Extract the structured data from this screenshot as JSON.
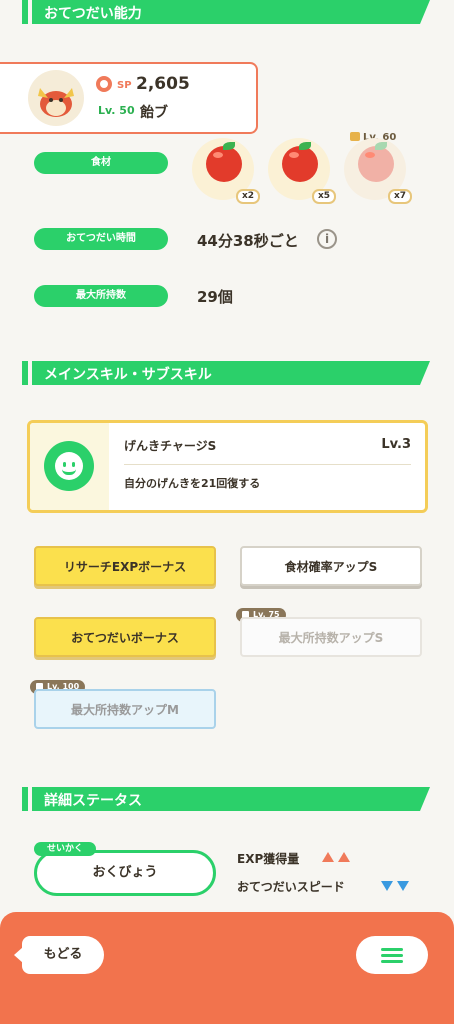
{
  "sections": {
    "skills_ability": "おてつだい能力",
    "main_sub_skill": "メインスキル・サブスキル",
    "detail_status": "詳細ステータス"
  },
  "profile": {
    "sp_label": "SP",
    "sp_value": "2,605",
    "level": "Lv. 50",
    "name": "飴ブ"
  },
  "ingredients": {
    "label": "食材",
    "items": [
      {
        "name": "apple",
        "qty": "x2"
      },
      {
        "name": "apple",
        "qty": "x5"
      },
      {
        "name": "apple",
        "qty": "x7",
        "lock_level": "Lv. 60"
      }
    ]
  },
  "help_time": {
    "label": "おてつだい時間",
    "value": "44分38秒ごと"
  },
  "max_capacity": {
    "label": "最大所持数",
    "value": "29個"
  },
  "main_skill": {
    "name": "げんきチャージS",
    "level": "Lv.3",
    "description": "自分のげんきを21回復する"
  },
  "sub_skills": [
    {
      "label": "リサーチEXPボーナス"
    },
    {
      "label": "食材確率アップS"
    },
    {
      "label": "おてつだいボーナス"
    },
    {
      "label": "最大所持数アップS",
      "lock_level": "Lv. 75"
    },
    {
      "label": "最大所持数アップM",
      "lock_level": "Lv. 100"
    }
  ],
  "nature": {
    "tag": "せいかく",
    "value": "おくびょう",
    "up_label": "EXP獲得量",
    "down_label": "おてつだいスピード"
  },
  "nav": {
    "back_label": "もどる"
  },
  "colors": {
    "accent_green": "#2bd06a",
    "accent_orange": "#f2734d",
    "gold": "#fbe04d"
  }
}
